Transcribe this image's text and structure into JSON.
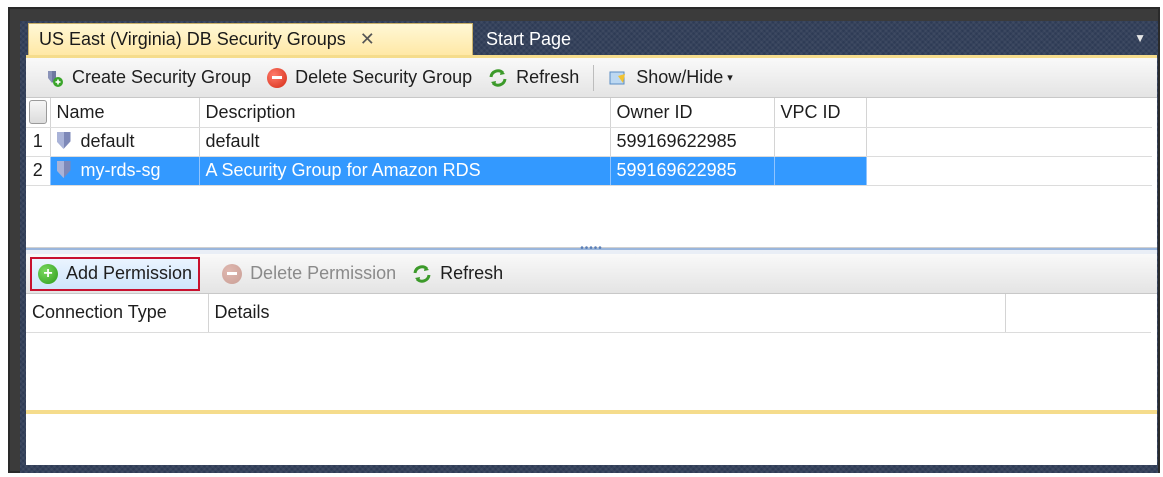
{
  "tabs": {
    "active_label": "US East (Virginia) DB Security Groups",
    "close_glyph": "✕",
    "inactive_label": "Start Page",
    "dropdown_glyph": "▼"
  },
  "toolbar": {
    "create_label": "Create Security Group",
    "delete_label": "Delete Security Group",
    "refresh_label": "Refresh",
    "showhide_label": "Show/Hide",
    "caret": "▾"
  },
  "grid": {
    "columns": {
      "name": "Name",
      "description": "Description",
      "owner": "Owner ID",
      "vpc": "VPC ID"
    },
    "rows": [
      {
        "num": "1",
        "name": "default",
        "description": "default",
        "owner": "599169622985",
        "vpc": ""
      },
      {
        "num": "2",
        "name": "my-rds-sg",
        "description": "A Security Group for Amazon RDS",
        "owner": "599169622985",
        "vpc": ""
      }
    ],
    "selected_row": 2
  },
  "splitter": {
    "grip": "•••••"
  },
  "toolbar2": {
    "add_label": "Add Permission",
    "delete_label": "Delete Permission",
    "refresh_label": "Refresh"
  },
  "grid2": {
    "columns": {
      "connection_type": "Connection Type",
      "details": "Details"
    }
  },
  "icons": {
    "create": "security-group-add-icon",
    "delete": "delete-icon",
    "refresh": "refresh-icon",
    "showhide": "show-hide-icon",
    "shield": "shield-icon",
    "add": "add-icon"
  },
  "colors": {
    "selection": "#3399ff",
    "highlight_border": "#c8102e",
    "tab_active": "#ffe8a6"
  }
}
